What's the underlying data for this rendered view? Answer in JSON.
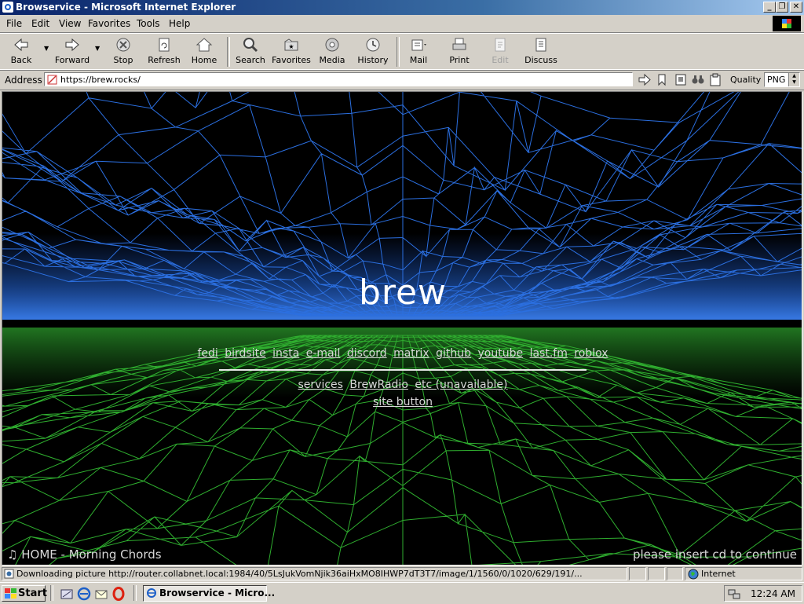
{
  "window": {
    "title": "Browservice - Microsoft Internet Explorer"
  },
  "menu": [
    "File",
    "Edit",
    "View",
    "Favorites",
    "Tools",
    "Help"
  ],
  "toolbar": {
    "back": "Back",
    "forward": "Forward",
    "stop": "Stop",
    "refresh": "Refresh",
    "home": "Home",
    "search": "Search",
    "favorites": "Favorites",
    "media": "Media",
    "history": "History",
    "mail": "Mail",
    "print": "Print",
    "edit": "Edit",
    "discuss": "Discuss"
  },
  "address": {
    "label": "Address",
    "url": "https://brew.rocks/"
  },
  "quality": {
    "label": "Quality",
    "value": "PNG"
  },
  "page": {
    "title": "brew",
    "links": [
      "fedi",
      "birdsite",
      "insta",
      "e-mail",
      "discord",
      "matrix",
      "github",
      "youtube",
      "last.fm",
      "roblox"
    ],
    "links2": [
      "services",
      "BrewRadio",
      "etc (unavailable)"
    ],
    "site_button": "site button",
    "now_playing": "HOME - Morning Chords",
    "insert_cd": "please insert cd to continue"
  },
  "status": {
    "text": "Downloading picture http://router.collabnet.local:1984/40/5LsJukVomNjik36aiHxMO8IHWP7dT3T7/image/1/1560/0/1020/629/191/...",
    "zone": "Internet"
  },
  "taskbar": {
    "start": "Start",
    "task": "Browservice - Micro...",
    "clock": "12:24 AM"
  },
  "colors": {
    "top_mesh": "#2b6fe0",
    "bottom_mesh": "#2fae2f",
    "background": "#000000"
  }
}
